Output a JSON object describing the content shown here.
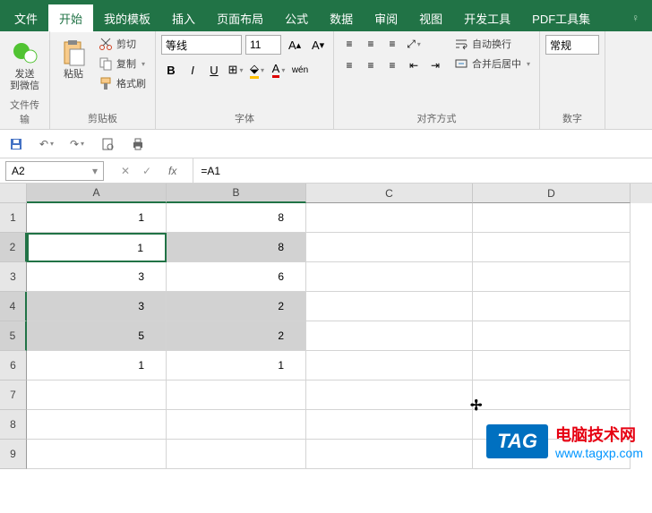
{
  "tabs": {
    "file": "文件",
    "home": "开始",
    "templates": "我的模板",
    "insert": "插入",
    "pageLayout": "页面布局",
    "formulas": "公式",
    "data": "数据",
    "review": "审阅",
    "view": "视图",
    "developer": "开发工具",
    "pdf": "PDF工具集"
  },
  "ribbon": {
    "wechat": {
      "send": "发送",
      "to": "到微信",
      "group": "文件传输"
    },
    "clipboard": {
      "paste": "粘贴",
      "cut": "剪切",
      "copy": "复制",
      "formatPainter": "格式刷",
      "group": "剪贴板"
    },
    "font": {
      "name": "等线",
      "size": "11",
      "group": "字体",
      "bold": "B",
      "italic": "I",
      "underline": "U",
      "wen": "wén"
    },
    "align": {
      "group": "对齐方式",
      "wrap": "自动换行",
      "merge": "合并后居中"
    },
    "number": {
      "general": "常规",
      "group": "数字"
    }
  },
  "nameBox": "A2",
  "formula": "=A1",
  "columns": [
    "A",
    "B",
    "C",
    "D"
  ],
  "rows": [
    {
      "n": 1,
      "a": "1",
      "b": "8",
      "h": false
    },
    {
      "n": 2,
      "a": "1",
      "b": "8",
      "h": true,
      "active": true
    },
    {
      "n": 3,
      "a": "3",
      "b": "6",
      "h": false
    },
    {
      "n": 4,
      "a": "3",
      "b": "2",
      "h": true
    },
    {
      "n": 5,
      "a": "5",
      "b": "2",
      "h": true
    },
    {
      "n": 6,
      "a": "1",
      "b": "1",
      "h": false
    },
    {
      "n": 7,
      "a": "",
      "b": "",
      "h": false
    },
    {
      "n": 8,
      "a": "",
      "b": "",
      "h": false
    },
    {
      "n": 9,
      "a": "",
      "b": "",
      "h": false
    }
  ],
  "watermark": {
    "badge": "TAG",
    "title": "电脑技术网",
    "url": "www.tagxp.com"
  }
}
